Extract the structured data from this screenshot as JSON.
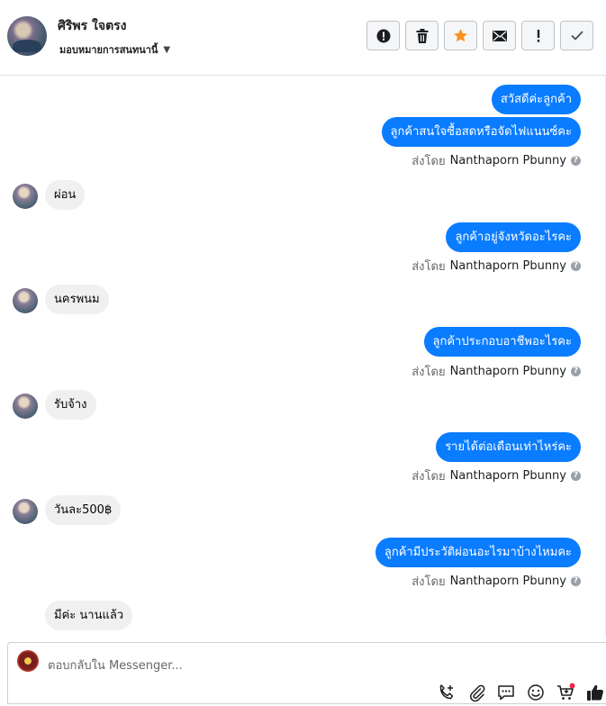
{
  "header": {
    "contact_name": "ศิริพร ใจตรง",
    "assign_label": "มอบหมายการสนทนานี้",
    "toolbar": [
      {
        "name": "spam-button",
        "icon": "alert-circle-icon"
      },
      {
        "name": "delete-button",
        "icon": "trash-icon"
      },
      {
        "name": "star-button",
        "icon": "star-icon"
      },
      {
        "name": "mark-unread-button",
        "icon": "envelope-icon"
      },
      {
        "name": "follow-up-button",
        "icon": "exclamation-icon"
      },
      {
        "name": "mark-done-button",
        "icon": "check-icon"
      }
    ]
  },
  "thread": {
    "sent_by_prefix": "ส่งโดย",
    "sender": "Nanthaporn Pbunny",
    "messages": [
      {
        "dir": "out",
        "text": "สวัสดีค่ะลูกค้า"
      },
      {
        "dir": "out",
        "text": "ลูกค้าสนใจซื้อสดหรือจัดไฟแนนซ์คะ"
      },
      {
        "dir": "in",
        "text": "ผ่อน"
      },
      {
        "dir": "out",
        "text": "ลูกค้าอยู่จังหวัดอะไรคะ"
      },
      {
        "dir": "in",
        "text": "นครพนม"
      },
      {
        "dir": "out",
        "text": "ลูกค้าประกอบอาชีพอะไรคะ"
      },
      {
        "dir": "in",
        "text": "รับจ้าง"
      },
      {
        "dir": "out",
        "text": "รายได้ต่อเดือนเท่าไหร่คะ"
      },
      {
        "dir": "in",
        "text": "วันละ500฿"
      },
      {
        "dir": "out",
        "text": "ลูกค้ามีประวัติผ่อนอะไรมาบ้างไหมคะ"
      },
      {
        "dir": "in",
        "text": "มีค่ะ นานแล้ว"
      }
    ]
  },
  "composer": {
    "placeholder": "ตอบกลับใน Messenger...",
    "icons": [
      "phone-plus-icon",
      "attachment-icon",
      "chat-bubble-icon",
      "emoji-icon",
      "cart-icon",
      "thumbs-up-icon"
    ],
    "colors": {
      "accent": "#0a7cff",
      "star": "#f7931e",
      "notification_dot": "#f02849"
    }
  }
}
